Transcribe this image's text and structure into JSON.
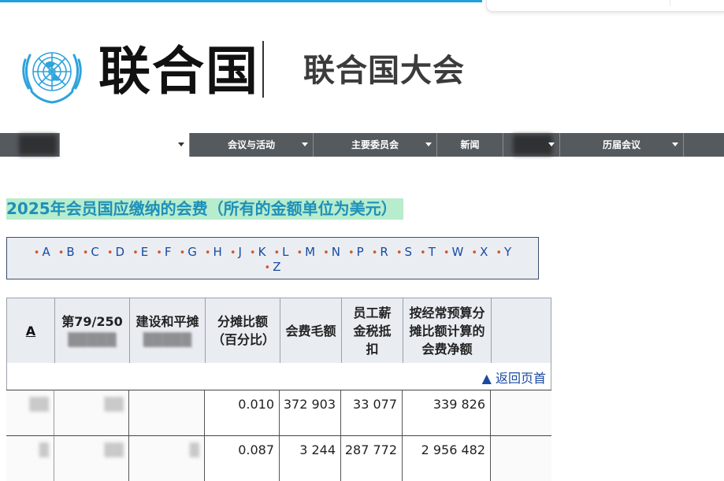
{
  "header": {
    "logo_text": "联合国",
    "section_title": "联合国大会"
  },
  "nav": {
    "items": [
      {
        "label": "会议与活动"
      },
      {
        "label": "主要委员会"
      },
      {
        "label": "新闻"
      },
      {
        "label": "历届会议"
      }
    ]
  },
  "page": {
    "title": "2025年会员国应缴纳的会费（所有的金额单位为美元）"
  },
  "alphabet": {
    "row1": [
      "A",
      "B",
      "C",
      "D",
      "E",
      "F",
      "G",
      "H",
      "J",
      "K",
      "L",
      "M",
      "N",
      "P",
      "R",
      "S",
      "T",
      "W",
      "X",
      "Y"
    ],
    "row2": [
      "Z"
    ]
  },
  "table": {
    "headers": {
      "col_a": "A",
      "col_resolution": "第79/250",
      "col_peacebuilding": "建设和平摊",
      "col_rate": "分摊比额（百分比）",
      "col_gross": "会费毛额",
      "col_staff": "员工薪金税抵扣",
      "col_net": "按经常预算分摊比额计算的会费净额"
    },
    "back_to_top": "▲ 返回页首",
    "rows": [
      {
        "rate": "0.010",
        "gross": "372 903",
        "staff": "33 077",
        "net": "339 826"
      },
      {
        "rate": "0.087",
        "gross": "3 244",
        "staff": "287 772",
        "net": "2 956 482"
      }
    ]
  },
  "colors": {
    "accent_blue": "#1fa0dc",
    "title_highlight": "#b7eccd",
    "nav_bg": "#555a5e",
    "link_blue": "#1a4aa0",
    "bullet_orange": "#d6562a"
  }
}
